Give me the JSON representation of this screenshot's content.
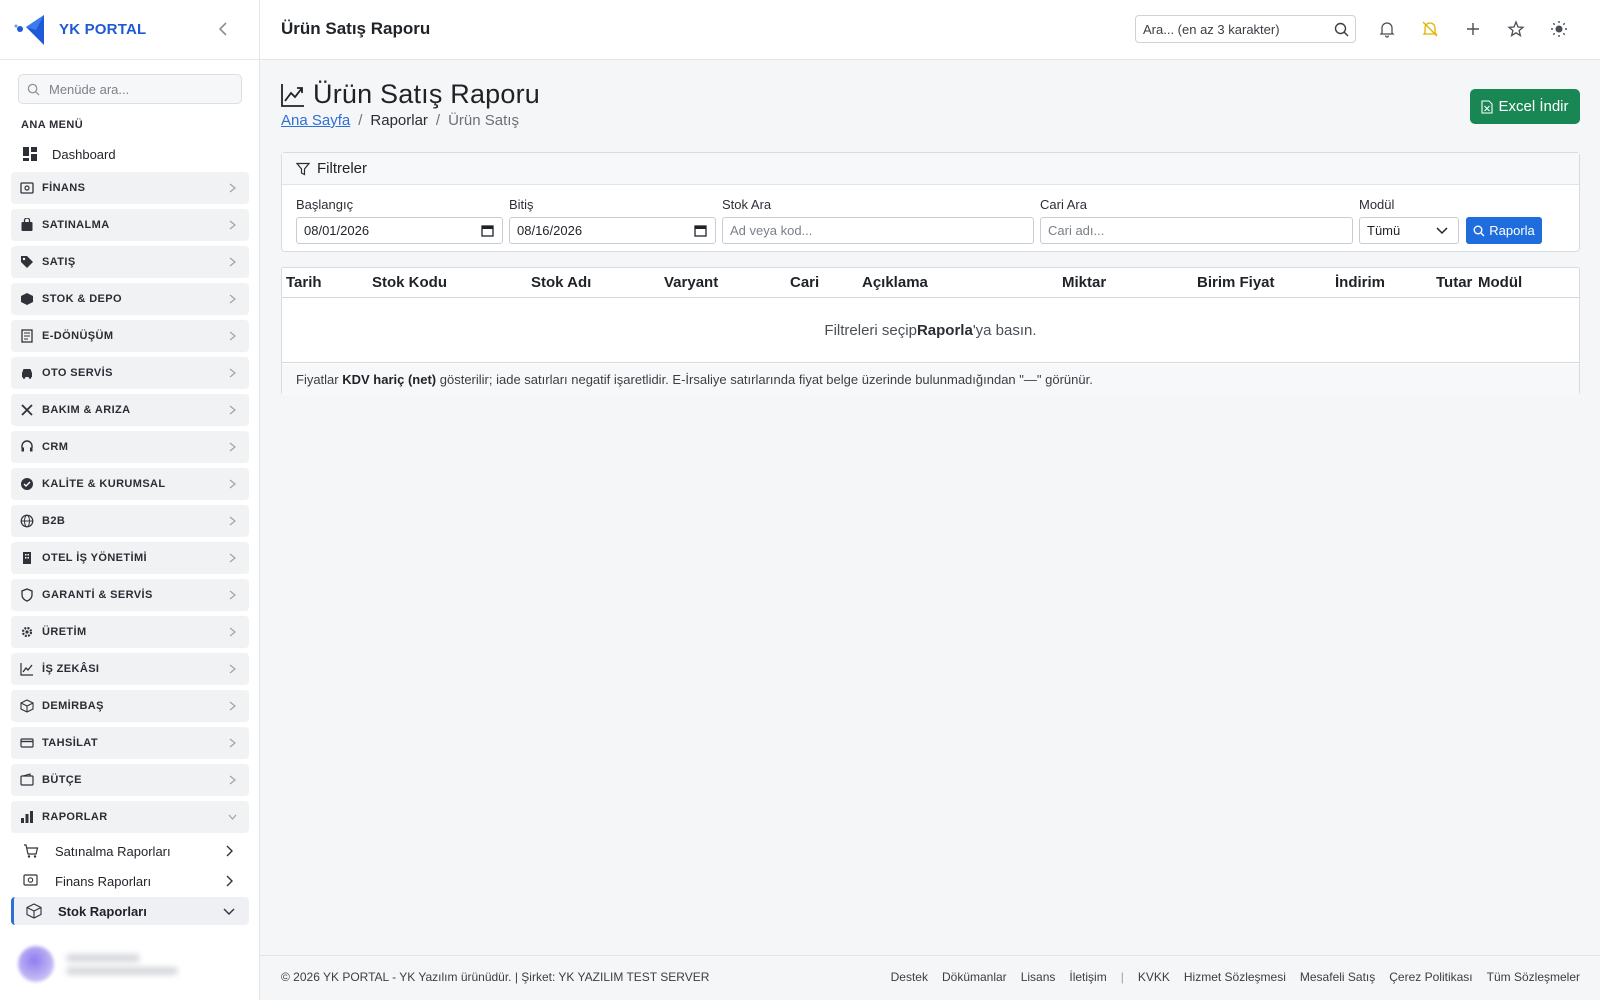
{
  "brand": {
    "name": "YK PORTAL"
  },
  "sidebar": {
    "search_placeholder": "Menüde ara...",
    "section_title": "ANA MENÜ",
    "dashboard": "Dashboard",
    "groups": [
      {
        "label": "FİNANS",
        "icon": "finance-icon"
      },
      {
        "label": "SATINALMA",
        "icon": "bag-icon"
      },
      {
        "label": "SATIŞ",
        "icon": "tag-icon"
      },
      {
        "label": "STOK & DEPO",
        "icon": "box-icon"
      },
      {
        "label": "E-DÖNÜŞÜM",
        "icon": "document-icon"
      },
      {
        "label": "OTO SERVİS",
        "icon": "car-icon"
      },
      {
        "label": "BAKIM & ARIZA",
        "icon": "tools-icon"
      },
      {
        "label": "CRM",
        "icon": "headset-icon"
      },
      {
        "label": "KALİTE & KURUMSAL",
        "icon": "badge-check-icon"
      },
      {
        "label": "B2B",
        "icon": "globe-icon"
      },
      {
        "label": "OTEL İŞ YÖNETİMİ",
        "icon": "building-icon"
      },
      {
        "label": "GARANTİ & SERVİS",
        "icon": "shield-icon"
      },
      {
        "label": "ÜRETİM",
        "icon": "gear-icon"
      },
      {
        "label": "İŞ ZEKÂSI",
        "icon": "chart-line-icon"
      },
      {
        "label": "DEMİRBAŞ",
        "icon": "cube-icon"
      },
      {
        "label": "TAHSİLAT",
        "icon": "credit-card-icon"
      },
      {
        "label": "BÜTÇE",
        "icon": "wallet-icon"
      },
      {
        "label": "RAPORLAR",
        "icon": "bar-chart-icon"
      }
    ],
    "sub_items": [
      {
        "label": "Satınalma Raporları",
        "icon": "cart-icon"
      },
      {
        "label": "Finans Raporları",
        "icon": "finance-icon"
      },
      {
        "label": "Stok Raporları",
        "icon": "box-icon"
      }
    ]
  },
  "topbar": {
    "title": "Ürün Satış Raporu",
    "search_placeholder": "Ara... (en az 3 karakter)"
  },
  "page": {
    "heading": "Ürün Satış Raporu",
    "breadcrumb": {
      "home": "Ana Sayfa",
      "reports": "Raporlar",
      "current": "Ürün Satış"
    },
    "excel_button": "Excel İndir"
  },
  "filters": {
    "title": "Filtreler",
    "start_label": "Başlangıç",
    "start_value": "08/01/2026",
    "end_label": "Bitiş",
    "end_value": "08/16/2026",
    "stock_label": "Stok Ara",
    "stock_placeholder": "Ad veya kod...",
    "account_label": "Cari Ara",
    "account_placeholder": "Cari adı...",
    "module_label": "Modül",
    "module_value": "Tümü",
    "submit": "Raporla"
  },
  "table": {
    "columns": [
      "Tarih",
      "Stok Kodu",
      "Stok Adı",
      "Varyant",
      "Cari",
      "Açıklama",
      "Miktar",
      "Birim Fiyat",
      "İndirim",
      "Tutar",
      "Modül"
    ],
    "empty_pre": "Filtreleri seçip ",
    "empty_bold": "Raporla",
    "empty_post": "'ya basın.",
    "note_pre": "Fiyatlar ",
    "note_bold": "KDV hariç (net)",
    "note_post": " gösterilir; iade satırları negatif işaretlidir. E-İrsaliye satırlarında fiyat belge üzerinde bulunmadığından \"—\" görünür."
  },
  "footer": {
    "copyright": "© 2026 YK PORTAL - YK Yazılım ürünüdür. | Şirket: YK YAZILIM TEST SERVER",
    "links_left": [
      "Destek",
      "Dökümanlar",
      "Lisans",
      "İletişim"
    ],
    "links_right": [
      "KVKK",
      "Hizmet Sözleşmesi",
      "Mesafeli Satış",
      "Çerez Politikası",
      "Tüm Sözleşmeler"
    ]
  },
  "colors": {
    "accent": "#1f6ddc",
    "excel": "#198754",
    "brand": "#1e5ad6",
    "notification_bell": "#e0b400"
  }
}
